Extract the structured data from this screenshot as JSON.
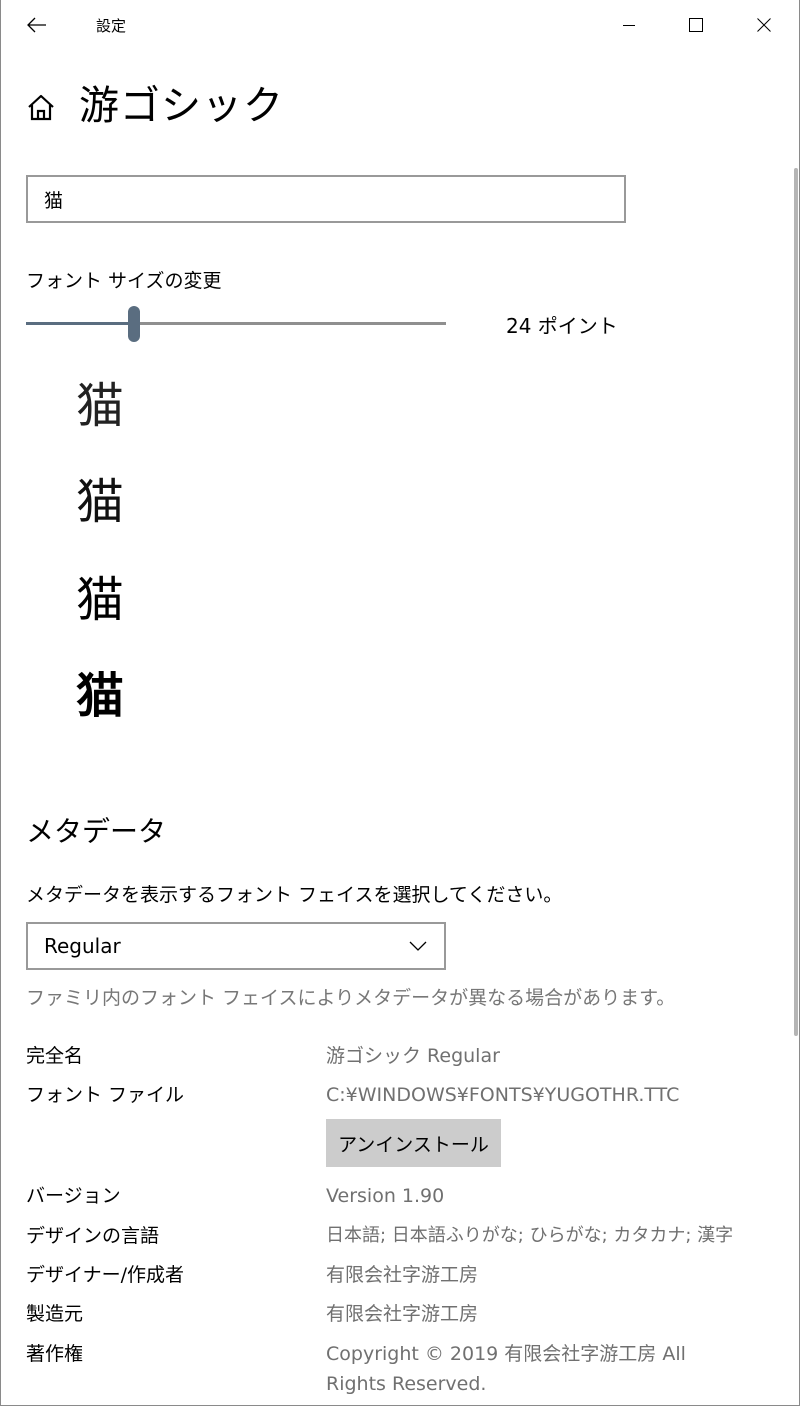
{
  "window": {
    "title": "設定"
  },
  "header": {
    "title": "游ゴシック"
  },
  "sample": {
    "text": "猫"
  },
  "font_size": {
    "label": "フォント サイズの変更",
    "value_text": "24 ポイント",
    "slider_fraction": 0.257
  },
  "previews": [
    {
      "text": "猫",
      "weight": "Light"
    },
    {
      "text": "猫",
      "weight": "Semilight"
    },
    {
      "text": "猫",
      "weight": "Regular"
    },
    {
      "text": "猫",
      "weight": "Bold"
    }
  ],
  "metadata": {
    "heading": "メタデータ",
    "instruction": "メタデータを表示するフォント フェイスを選択してください。",
    "selected_face": "Regular",
    "note": "ファミリ内のフォント フェイスによりメタデータが異なる場合があります。",
    "rows": {
      "full_name": {
        "key": "完全名",
        "value": "游ゴシック Regular"
      },
      "font_file": {
        "key": "フォント ファイル",
        "value": "C:¥WINDOWS¥FONTS¥YUGOTHR.TTC"
      },
      "version": {
        "key": "バージョン",
        "value": "Version 1.90"
      },
      "design_language": {
        "key": "デザインの言語",
        "value": "日本語; 日本語ふりがな; ひらがな; カタカナ; 漢字"
      },
      "designer": {
        "key": "デザイナー/作成者",
        "value": "有限会社字游工房"
      },
      "manufacturer": {
        "key": "製造元",
        "value": "有限会社字游工房"
      },
      "copyright": {
        "key": "著作権",
        "value": "Copyright © 2019 有限会社字游工房 All Rights Reserved."
      }
    },
    "uninstall_label": "アンインストール"
  },
  "colors": {
    "slider_accent": "#5a6d80",
    "secondary_text": "#707070",
    "button_bg": "#cccccc"
  }
}
